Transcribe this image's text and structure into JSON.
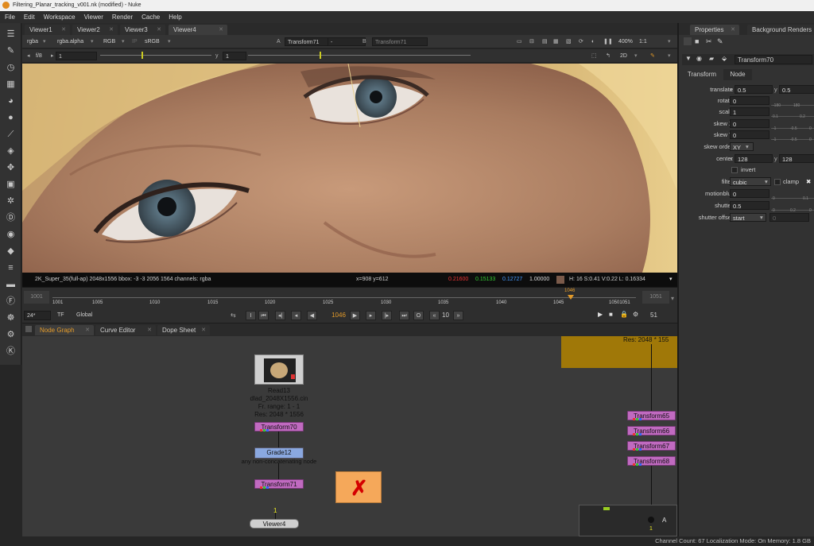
{
  "window": {
    "title": "Filtering_Planar_tracking_v001.nk (modified) - Nuke"
  },
  "menu": [
    "File",
    "Edit",
    "Workspace",
    "Viewer",
    "Render",
    "Cache",
    "Help"
  ],
  "viewer_tabs": [
    "Viewer1",
    "Viewer2",
    "Viewer3",
    "Viewer4"
  ],
  "viewer_controls": {
    "channels": "rgba",
    "alpha": "rgba.alpha",
    "display": "RGB",
    "colorspace": "sRGB",
    "input_a_label": "A",
    "input_a": "Transform71",
    "input_sep": "-",
    "input_b_label": "B",
    "input_b": "Transform71",
    "zoom": "400%",
    "ratio": "1:1",
    "fstop": "f/8",
    "frame_gain": "1",
    "gamma_label": "y",
    "gamma": "1",
    "view_mode": "2D"
  },
  "info": {
    "format": "2K_Super_35(full-ap) 2048x1556  bbox: -3 -3 2056 1564 channels: rgba",
    "coords": "x=908 y=612",
    "r": "0.21600",
    "g": "0.15133",
    "b": "0.12727",
    "a": "1.00000",
    "hsvl": "H: 16 S:0.41 V:0.22  L: 0.16334"
  },
  "timeline": {
    "in": "1001",
    "out": "1051",
    "ticks": [
      "1001",
      "1005",
      "1010",
      "1015",
      "1020",
      "1025",
      "1030",
      "1035",
      "1040",
      "1045",
      "10501051"
    ],
    "current_marker": "1046"
  },
  "transport": {
    "fps": "24*",
    "tf": "TF",
    "mode": "Global",
    "frame": "1046",
    "step": "10",
    "end": "51"
  },
  "node_tabs": [
    "Node Graph",
    "Curve Editor",
    "Dope Sheet"
  ],
  "nodes": {
    "read_name": "Read13",
    "read_file": "dlad_2048X1556.cin",
    "read_range": "Fr. range: 1 - 1",
    "read_res": "Res: 2048 * 1556",
    "transform70": "Transform70",
    "grade": "Grade12",
    "grade_note": "any non-concatenating node",
    "transform71": "Transform71",
    "viewer": "Viewer4",
    "input_num": "1",
    "right_res": "Res: 2048 * 155",
    "transform65": "Transform65",
    "transform66": "Transform66",
    "transform67": "Transform67",
    "transform68": "Transform68",
    "a_label": "A",
    "mini_num": "1"
  },
  "properties": {
    "tabs": [
      "Properties",
      "Background Renders"
    ],
    "node_name": "Transform70",
    "subtabs": [
      "Transform",
      "Node"
    ],
    "rows": [
      {
        "label": "translate",
        "x_label": "x",
        "x": "0.5",
        "y_label": "y",
        "y": "0.5"
      },
      {
        "label": "rotate",
        "value": "0",
        "ticks": [
          "-180",
          "180"
        ]
      },
      {
        "label": "scale",
        "value": "1",
        "ticks": [
          "0.1",
          "0.2"
        ]
      },
      {
        "label": "skew X",
        "value": "0",
        "ticks": [
          "-1",
          "-0.5",
          "0"
        ]
      },
      {
        "label": "skew Y",
        "value": "0",
        "ticks": [
          "-1",
          "-0.5",
          "0"
        ]
      },
      {
        "label": "skew order",
        "value": "XY"
      },
      {
        "label": "center",
        "x_label": "x",
        "x": "128",
        "y_label": "y",
        "y": "128"
      },
      {
        "label": "",
        "check": "invert"
      },
      {
        "label": "filter",
        "value": "cubic",
        "check": "clamp"
      },
      {
        "label": "motionblur",
        "value": "0",
        "ticks": [
          "0",
          "0.1"
        ]
      },
      {
        "label": "shutter",
        "value": "0.5",
        "ticks": [
          "0",
          "0.2",
          "0"
        ]
      },
      {
        "label": "shutter offset",
        "value": "start",
        "extra": "0"
      }
    ]
  },
  "status": "Channel Count: 67  Localization Mode: On  Memory: 1.8 GB"
}
